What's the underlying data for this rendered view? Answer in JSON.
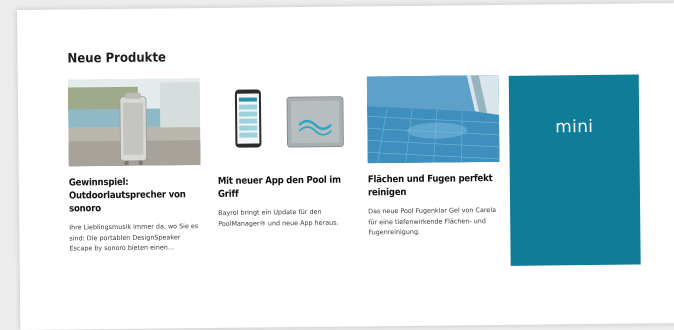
{
  "section": {
    "title": "Neue Produkte"
  },
  "cards": [
    {
      "headline": "Gewinnspiel: Outdoorlautsprecher von sonoro",
      "teaser": "Ihre Lieblingsmusik immer da, wo Sie es sind: Die portablen DesignSpeaker Escape by sonoro bieten einen…",
      "image_icon": "outdoor-speaker-poolside-image"
    },
    {
      "headline": "Mit neuer App den Pool im Griff",
      "teaser": "Bayrol bringt ein Update für den PoolManager® und neue App heraus.",
      "image_icon": "smartphone-pool-controller-image"
    },
    {
      "headline": "Flächen und Fugen perfekt reinigen",
      "teaser": "Das neue Pool Fugenklar Gel von Carela für eine tiefenwirkende Flächen- und Fugenreinigung.",
      "image_icon": "tiled-pool-image"
    }
  ],
  "ad": {
    "label": "mini",
    "color": "#0f7c98"
  }
}
